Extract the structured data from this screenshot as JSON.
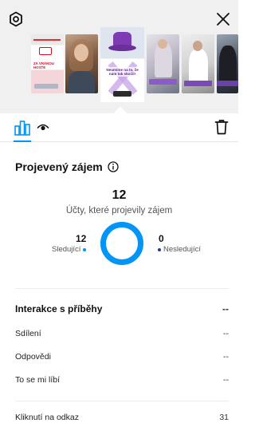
{
  "header": {
    "settings_icon": "gear-icon",
    "close_icon": "close-icon"
  },
  "stories": [
    {
      "title": "ZA VRÁNOU HOSTE"
    },
    {
      "title": ""
    },
    {
      "title": "Neumíme na to, že nám tak skočil!"
    },
    {
      "title": ""
    },
    {
      "title": ""
    },
    {
      "title": ""
    }
  ],
  "tabs": {
    "insights_icon": "bar-chart-icon",
    "views_icon": "eye-icon",
    "delete_icon": "trash-icon"
  },
  "interest": {
    "title": "Projevený zájem",
    "total": "12",
    "total_label": "Účty, které projevily zájem",
    "followers_value": "12",
    "followers_label": "Sledující",
    "non_followers_value": "0",
    "non_followers_label": "Nesledující",
    "followers_fraction": 1.0,
    "accent_color": "#0095f6",
    "secondary_color": "#1c3f8f"
  },
  "interactions": {
    "title": "Interakce s příběhy",
    "value": "--",
    "rows": [
      {
        "label": "Sdílení",
        "value": "--"
      },
      {
        "label": "Odpovědi",
        "value": "--"
      },
      {
        "label": "To se mi líbí",
        "value": "--"
      }
    ]
  },
  "link_clicks": {
    "label": "Kliknutí na odkaz",
    "value": "31"
  }
}
